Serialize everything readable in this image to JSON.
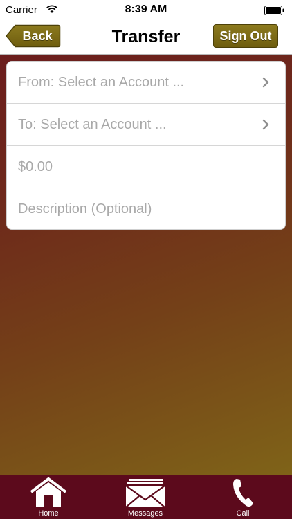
{
  "status_bar": {
    "carrier": "Carrier",
    "time": "8:39 AM"
  },
  "nav": {
    "title": "Transfer",
    "back_label": "Back",
    "sign_out_label": "Sign Out"
  },
  "form": {
    "from_placeholder": "From: Select an Account ...",
    "to_placeholder": "To: Select an Account ...",
    "amount_placeholder": "$0.00",
    "description_placeholder": "Description (Optional)"
  },
  "tabs": [
    {
      "label": "Home",
      "icon": "home-icon"
    },
    {
      "label": "Messages",
      "icon": "envelope-icon"
    },
    {
      "label": "Call",
      "icon": "phone-icon"
    }
  ],
  "colors": {
    "accent_gold": "#7a6a16",
    "tab_bar": "#5c0a1c",
    "background_top": "#6b1d1d",
    "background_bottom": "#7f6318"
  }
}
